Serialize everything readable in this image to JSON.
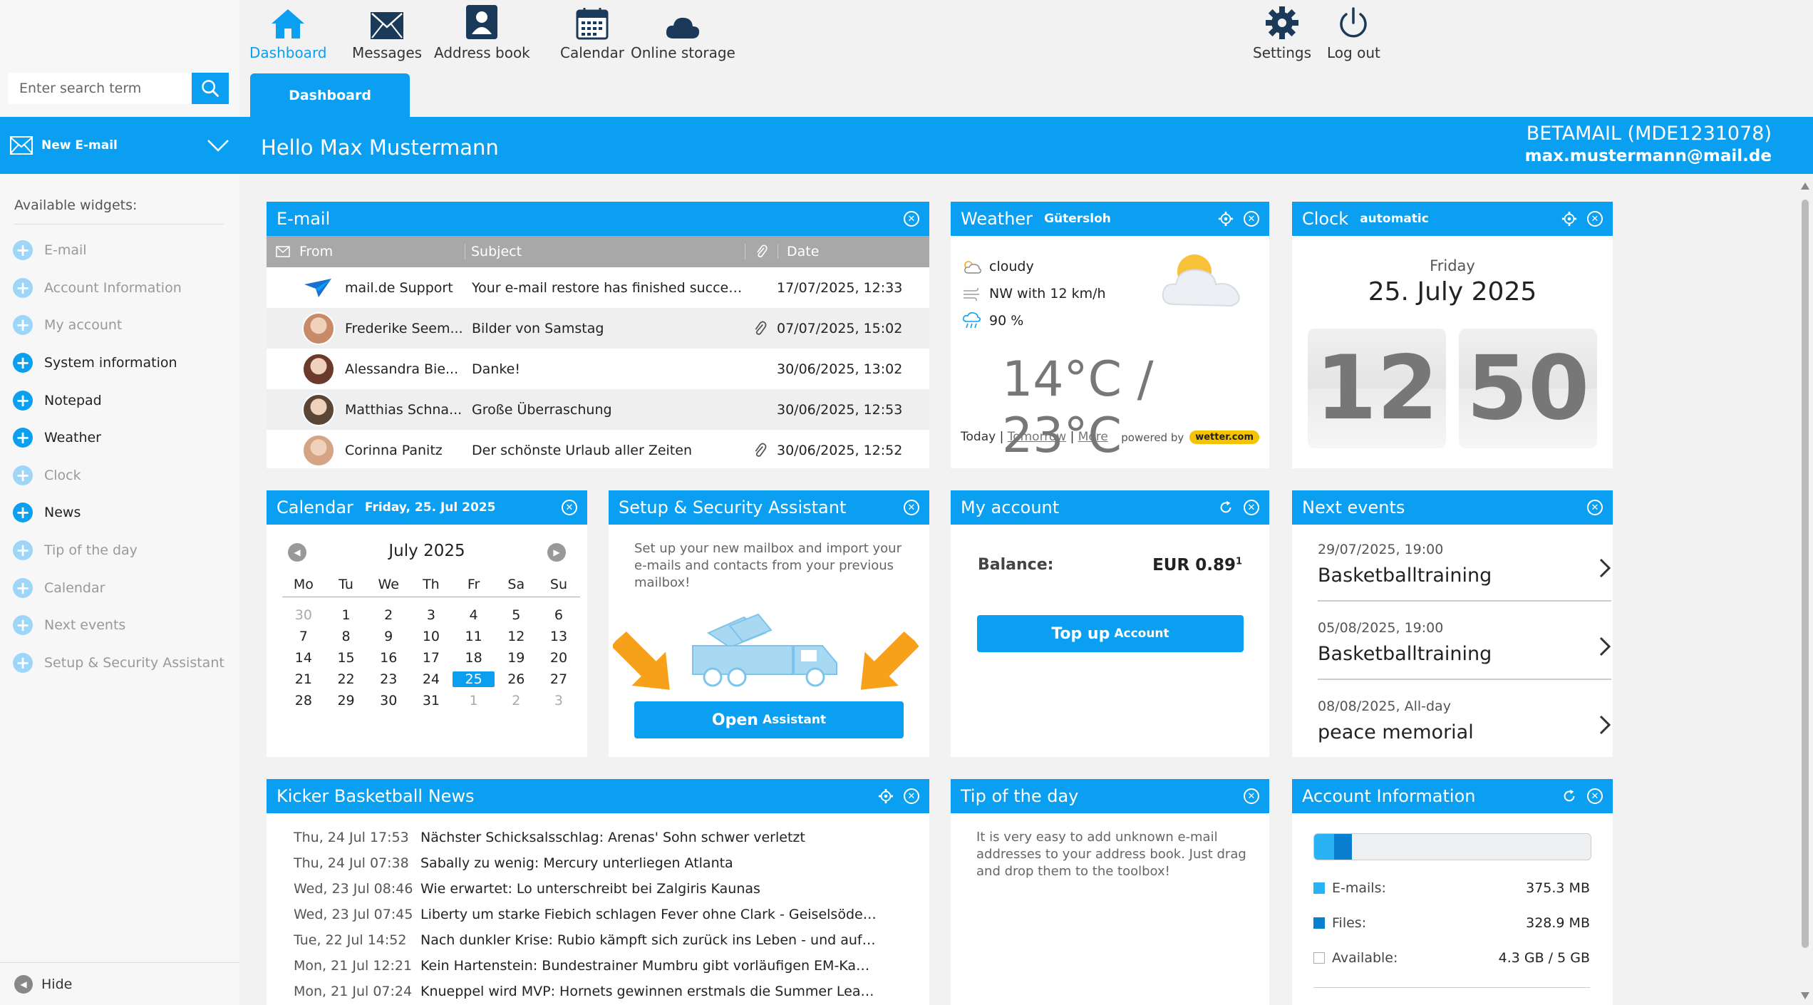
{
  "search": {
    "placeholder": "Enter search term"
  },
  "sidebar": {
    "new_email": "New E-mail",
    "widgets_title": "Available widgets:",
    "widgets": [
      {
        "label": "E-mail",
        "state": "off"
      },
      {
        "label": "Account Information",
        "state": "off"
      },
      {
        "label": "My account",
        "state": "off"
      },
      {
        "label": "System information",
        "state": "on"
      },
      {
        "label": "Notepad",
        "state": "on"
      },
      {
        "label": "Weather",
        "state": "on"
      },
      {
        "label": "Clock",
        "state": "off"
      },
      {
        "label": "News",
        "state": "on"
      },
      {
        "label": "Tip of the day",
        "state": "off"
      },
      {
        "label": "Calendar",
        "state": "off"
      },
      {
        "label": "Next events",
        "state": "off"
      },
      {
        "label": "Setup & Security Assistant",
        "state": "off"
      }
    ],
    "hide": "Hide"
  },
  "nav": {
    "dashboard": "Dashboard",
    "messages": "Messages",
    "address_book": "Address book",
    "calendar": "Calendar",
    "online_storage": "Online storage",
    "settings": "Settings",
    "logout": "Log out"
  },
  "tab": {
    "label": "Dashboard"
  },
  "header": {
    "greeting": "Hello Max Mustermann",
    "account_id": "BETAMAIL (MDE1231078)",
    "account_email": "max.mustermann@mail.de"
  },
  "email": {
    "title": "E-mail",
    "col_from": "From",
    "col_subject": "Subject",
    "col_date": "Date",
    "rows": [
      {
        "from": "mail.de Support",
        "subject": "Your e-mail restore has finished succes...",
        "date": "17/07/2025, 12:33",
        "attach": false,
        "avatar": "logo"
      },
      {
        "from": "Frederike Seem...",
        "subject": "Bilder von Samstag",
        "date": "07/07/2025, 15:02",
        "attach": true,
        "avatar": "#c98a6a"
      },
      {
        "from": "Alessandra Bie...",
        "subject": "Danke!",
        "date": "30/06/2025, 13:02",
        "attach": false,
        "avatar": "#6b3a2a"
      },
      {
        "from": "Matthias Schna...",
        "subject": "Große Überraschung",
        "date": "30/06/2025, 12:53",
        "attach": false,
        "avatar": "#5a4636"
      },
      {
        "from": "Corinna Panitz",
        "subject": "Der schönste Urlaub aller Zeiten",
        "date": "30/06/2025, 12:52",
        "attach": true,
        "avatar": "#d4a484"
      }
    ]
  },
  "weather": {
    "title": "Weather",
    "location": "Gütersloh",
    "condition": "cloudy",
    "wind": "NW with 12 km/h",
    "rain": "90 %",
    "temp": "14°C / 23°C",
    "today": "Today",
    "tomorrow": "Tomorrow",
    "more": "More",
    "powered": "powered by",
    "brand": "wetter.com"
  },
  "clock": {
    "title": "Clock",
    "mode": "automatic",
    "weekday": "Friday",
    "date": "25. July 2025",
    "hour": "12",
    "minute": "50"
  },
  "calendar": {
    "title": "Calendar",
    "date": "Friday, 25. Jul 2025",
    "month": "July 2025",
    "weekdays": [
      "Mo",
      "Tu",
      "We",
      "Th",
      "Fr",
      "Sa",
      "Su"
    ],
    "weeks": [
      [
        "30",
        "1",
        "2",
        "3",
        "4",
        "5",
        "6"
      ],
      [
        "7",
        "8",
        "9",
        "10",
        "11",
        "12",
        "13"
      ],
      [
        "14",
        "15",
        "16",
        "17",
        "18",
        "19",
        "20"
      ],
      [
        "21",
        "22",
        "23",
        "24",
        "25",
        "26",
        "27"
      ],
      [
        "28",
        "29",
        "30",
        "31",
        "1",
        "2",
        "3"
      ]
    ],
    "today": "25"
  },
  "setup": {
    "title": "Setup & Security Assistant",
    "text": "Set up your new mailbox and import your e-mails and contacts from your previous mailbox!",
    "button_big": "Open",
    "button_small": "Assistant"
  },
  "my_account": {
    "title": "My account",
    "balance_label": "Balance:",
    "balance_value": "EUR 0.89",
    "balance_note": "1",
    "button_big": "Top up",
    "button_small": "Account"
  },
  "next_events": {
    "title": "Next events",
    "items": [
      {
        "date": "29/07/2025, 19:00",
        "title": "Basketballtraining"
      },
      {
        "date": "05/08/2025, 19:00",
        "title": "Basketballtraining"
      },
      {
        "date": "08/08/2025, All-day",
        "title": "peace memorial"
      }
    ]
  },
  "news": {
    "title": "Kicker Basketball News",
    "items": [
      {
        "date": "Thu, 24 Jul 17:53",
        "text": "Nächster Schicksalsschlag: Arenas' Sohn schwer verletzt"
      },
      {
        "date": "Thu, 24 Jul 07:38",
        "text": "Sabally zu wenig: Mercury unterliegen Atlanta"
      },
      {
        "date": "Wed, 23 Jul 08:46",
        "text": "Wie erwartet: Lo unterschreibt bei Zalgiris Kaunas"
      },
      {
        "date": "Wed, 23 Jul 07:45",
        "text": "Liberty um starke Fiebich schlagen Fever ohne Clark - Geiselsöder e..."
      },
      {
        "date": "Tue, 22 Jul 14:52",
        "text": "Nach dunkler Krise: Rubio kämpft sich zurück ins Leben - und aufs P..."
      },
      {
        "date": "Mon, 21 Jul 12:21",
        "text": "Kein Hartenstein: Bundestrainer Mumbru gibt vorläufigen EM-Kader ..."
      },
      {
        "date": "Mon, 21 Jul 07:24",
        "text": "Knueppel wird MVP: Hornets gewinnen erstmals die Summer League"
      }
    ]
  },
  "tip": {
    "title": "Tip of the day",
    "text": "It is very easy to add unknown e-mail addresses to your address book. Just drag and drop them to the toolbox!"
  },
  "account_info": {
    "title": "Account Information",
    "emails_label": "E-mails:",
    "emails_value": "375.3 MB",
    "files_label": "Files:",
    "files_value": "328.9 MB",
    "available_label": "Available:",
    "available_value": "4.3 GB / 5 GB",
    "emails_fraction": 0.073,
    "files_fraction": 0.064,
    "colors": {
      "emails": "#29b3f5",
      "files": "#0a7fd0"
    }
  },
  "colors": {
    "accent": "#0a9ff0"
  }
}
